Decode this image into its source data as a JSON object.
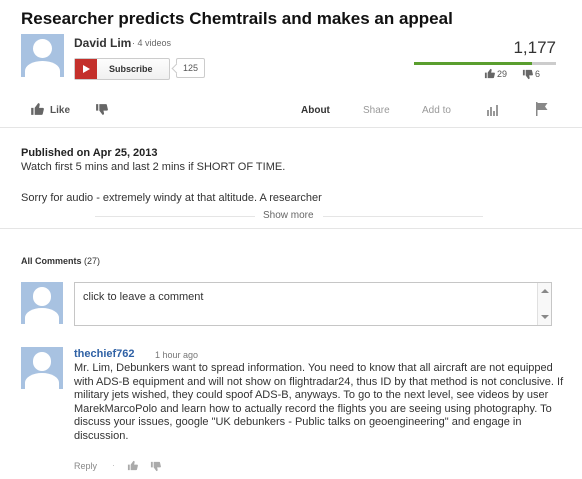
{
  "video": {
    "title": "Researcher predicts Chemtrails and makes an appeal",
    "channel": "David Lim",
    "video_count": "· 4 videos",
    "subscribe_label": "Subscribe",
    "subscriber_count": "125",
    "view_count": "1,177",
    "likes": "29",
    "dislikes": "6",
    "like_ratio": 0.83
  },
  "actions": {
    "like": "Like",
    "about": "About",
    "share": "Share",
    "add_to": "Add to"
  },
  "description": {
    "published": "Published on Apr 25, 2013",
    "line1": "Watch first 5 mins and last 2 mins if SHORT OF TIME.",
    "line2": "Sorry for audio - extremely windy at that altitude. A researcher",
    "show_more": "Show more"
  },
  "comments": {
    "header_label": "All Comments",
    "header_count": "(27)",
    "placeholder": "click to leave a comment",
    "items": [
      {
        "author": "thechief762",
        "time": "1 hour ago",
        "text": "Mr. Lim, Debunkers want to spread information. You need to know that all aircraft are not equipped with ADS-B equipment and will not show on flightradar24, thus ID by that method is not conclusive. If military jets wished, they could spoof ADS-B, anyways. To go to the next level, see videos by user MarekMarcoPolo and learn how to actually record the flights you are seeing using photography. To discuss your issues, google \"UK debunkers - Public talks on geoengineering\" and engage in discussion.",
        "reply_label": "Reply",
        "separator": "·"
      }
    ]
  },
  "colors": {
    "subscribe_red": "#c4302b",
    "like_bar_green": "#5a9e2e",
    "author_link": "#2f61a5",
    "avatar_blue": "#a8c2e1"
  }
}
